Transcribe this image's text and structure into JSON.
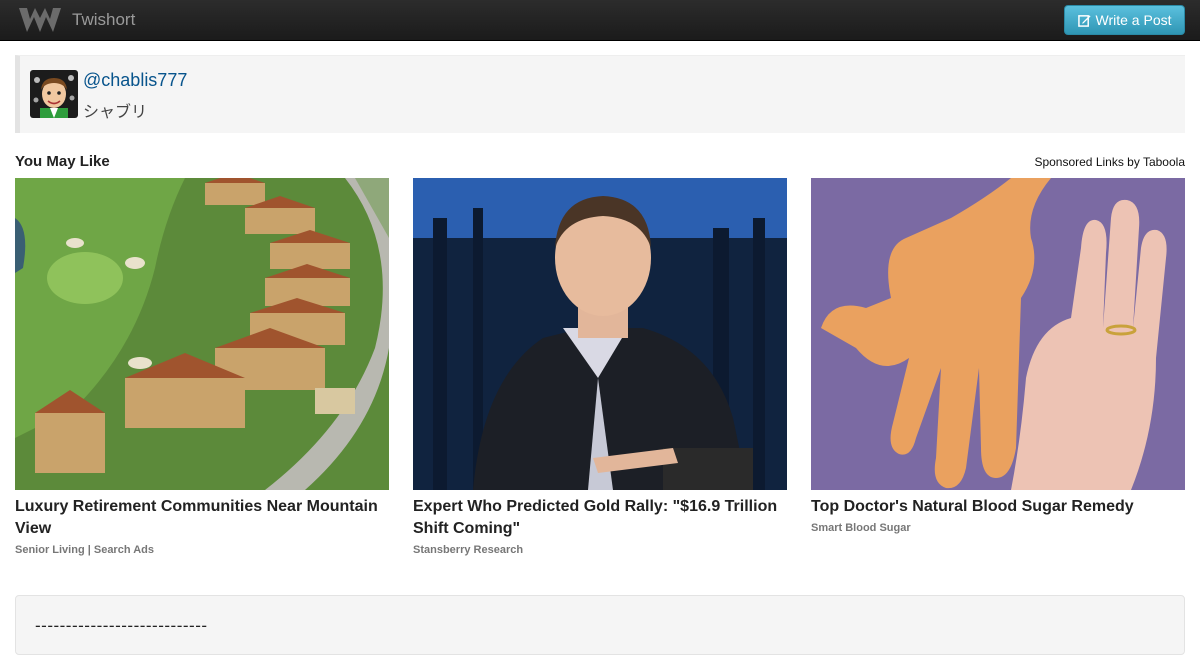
{
  "navbar": {
    "brand_name": "Twishort",
    "brand_icon": "twishort-logo-icon",
    "write_button_label": "Write a Post",
    "write_button_icon": "edit-icon"
  },
  "profile": {
    "handle_at": "@",
    "handle": "chablis777",
    "display_name": "シャブリ"
  },
  "recommendations": {
    "title": "You May Like",
    "sponsored_label": "Sponsored Links by Taboola",
    "items": [
      {
        "headline": "Luxury Retirement Communities Near Mountain View",
        "source": "Senior Living | Search Ads",
        "image": "aerial-houses-golf-course-image"
      },
      {
        "headline": "Expert Who Predicted Gold Rally: \"$16.9 Trillion Shift Coming\"",
        "source": "Stansberry Research",
        "image": "speaker-on-stage-image"
      },
      {
        "headline": "Top Doctor's Natural Blood Sugar Remedy",
        "source": "Smart Blood Sugar",
        "image": "two-hands-palms-image"
      }
    ]
  },
  "tweet": {
    "text": "----------------------------"
  },
  "colors": {
    "navbar_bg": "#1b1b1b",
    "button_accent": "#2f96b4",
    "link": "#08548c",
    "card_bg": "#f5f5f5"
  }
}
